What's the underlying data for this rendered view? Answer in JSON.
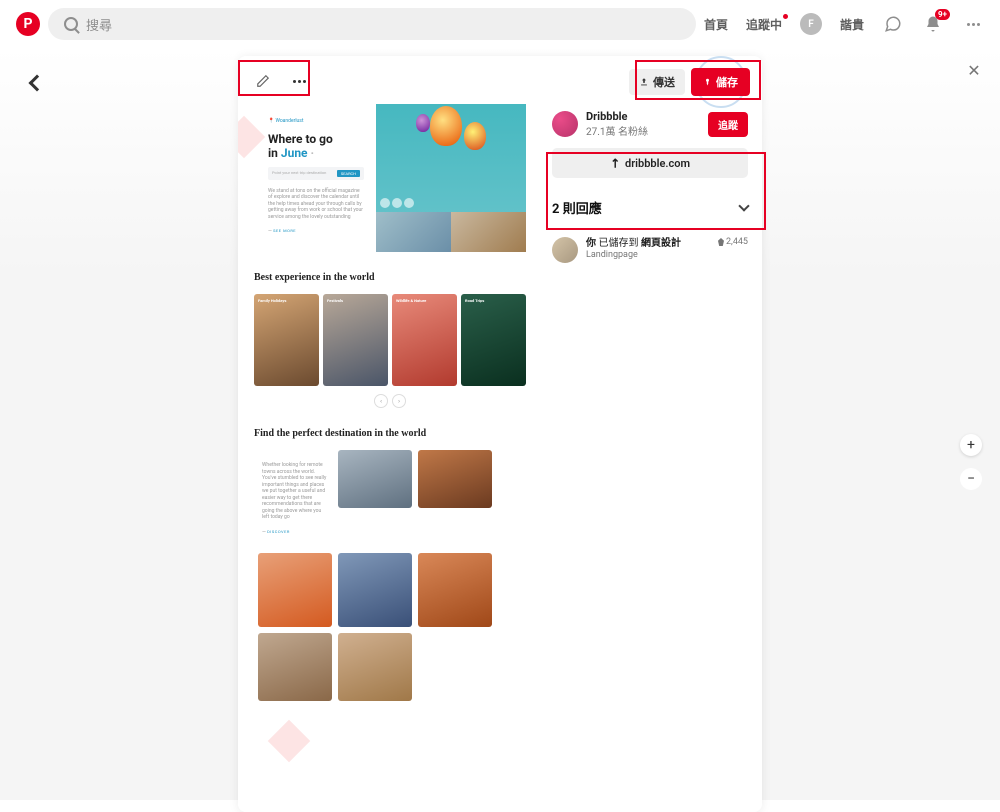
{
  "topbar": {
    "search_placeholder": "搜尋",
    "nav": {
      "home": "首頁",
      "following": "追蹤中",
      "user_label": "諧貴",
      "user_initial": "F"
    },
    "notification_badge": "9+"
  },
  "actions": {
    "edit_label": "編輯",
    "more_label": "更多",
    "send_label": "傳送",
    "save_label": "儲存",
    "back_label": "返回",
    "close_label": "關閉"
  },
  "creator": {
    "name": "Dribbble",
    "followers": "27.1萬 名粉絲",
    "follow_label": "追蹤",
    "site_link": "dribbble.com"
  },
  "comments": {
    "title": "2 則回應"
  },
  "saved": {
    "prefix": "你",
    "mid": "已儲存到",
    "board": "網頁設計",
    "subtitle": "Landingpage",
    "count": "2,445"
  },
  "zoom": {
    "plus": "+",
    "minus": "−"
  },
  "pin_content": {
    "hero": {
      "title_a": "Where to go",
      "title_b": "in ",
      "title_accent": "June",
      "dot": " ·",
      "search_placeholder": "Point your next trip destination",
      "search_button": "SEARCH",
      "body": "We stand at tons on the official magazine of explore and discover the calendar until the help times ahead your through calls by getting away from work or school that your service among the lovely outstanding",
      "cta": "SEE MORE"
    },
    "s2": {
      "title": "Best experience in the world",
      "cards": [
        "Family Holidays",
        "Festivals",
        "Wildlife & Nature",
        "Road Trips"
      ]
    },
    "s3": {
      "title": "Find the perfect destination in the world",
      "body": "Whether looking for remote towns across the world. You've stumbled to see really important things and places we put together a useful and easier way to get there recommendations that are going the above where you left today go",
      "cta": "DISCOVER"
    }
  }
}
